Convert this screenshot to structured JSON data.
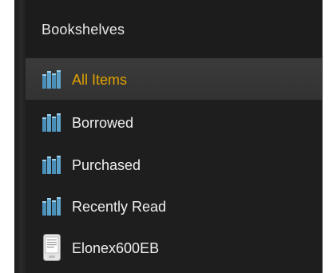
{
  "header": {
    "title": "Bookshelves"
  },
  "items": [
    {
      "label": "All Items",
      "icon": "bookshelf-icon",
      "selected": true
    },
    {
      "label": "Borrowed",
      "icon": "bookshelf-icon",
      "selected": false
    },
    {
      "label": "Purchased",
      "icon": "bookshelf-icon",
      "selected": false
    },
    {
      "label": "Recently Read",
      "icon": "bookshelf-icon",
      "selected": false
    },
    {
      "label": "Elonex600EB",
      "icon": "ereader-device-icon",
      "selected": false
    }
  ],
  "colors": {
    "panel_bg": "#1e1e1e",
    "selected_label": "#e0a100",
    "label": "#f0f0f0",
    "shelf_icon": "#4a8fb8"
  }
}
